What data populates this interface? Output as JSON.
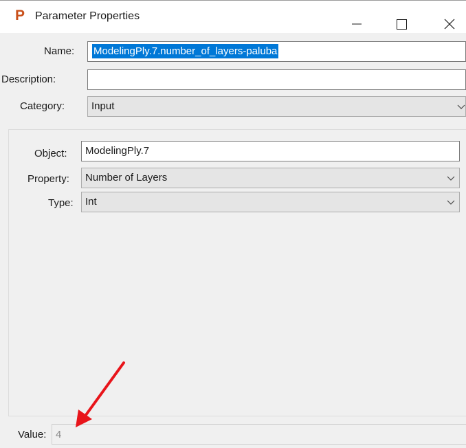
{
  "window": {
    "title": "Parameter Properties",
    "icon_letter": "P",
    "icon_color": "#c9501a"
  },
  "form": {
    "name_label": "Name:",
    "name_value": "ModelingPly.7.number_of_layers-paluba",
    "description_label": "Description:",
    "description_value": "",
    "category_label": "Category:",
    "category_value": "Input"
  },
  "details": {
    "object_label": "Object:",
    "object_value": "ModelingPly.7",
    "property_label": "Property:",
    "property_value": "Number of Layers",
    "type_label": "Type:",
    "type_value": "Int"
  },
  "footer": {
    "value_label": "Value:",
    "value_value": "4"
  },
  "annotation": {
    "arrow_color": "#e8141a"
  },
  "colors": {
    "selection": "#0078d7",
    "background": "#f0f0f0"
  }
}
